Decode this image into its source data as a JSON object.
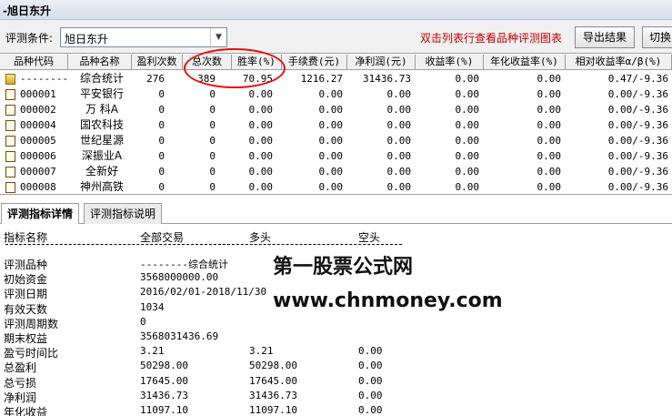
{
  "title": "-旭日东升",
  "toolbar": {
    "condition_label": "评测条件:",
    "condition_value": "旭日东升",
    "hint": "双击列表行查看品种评测图表",
    "export_label": "导出结果",
    "switch_label": "切换"
  },
  "table": {
    "headers": [
      "品种代码",
      "品种名称",
      "盈利次数",
      "总次数",
      "胜率(%)",
      "手续费(元)",
      "净利润(元)",
      "收益率(%)",
      "年化收益率(%)",
      "相对收益率α/β(%)"
    ],
    "rows": [
      {
        "code": "--------",
        "name": "综合统计",
        "win": "276",
        "total": "389",
        "rate": "70.95",
        "fee": "1216.27",
        "profit": "31436.73",
        "ret": "0.00",
        "annual": "0.00",
        "rel": "0.47/-9.36"
      },
      {
        "code": "000001",
        "name": "平安银行",
        "win": "0",
        "total": "0",
        "rate": "0.00",
        "fee": "0.00",
        "profit": "0.00",
        "ret": "0.00",
        "annual": "0.00",
        "rel": "0.00/-9.36"
      },
      {
        "code": "000002",
        "name": "万 科A",
        "win": "0",
        "total": "0",
        "rate": "0.00",
        "fee": "0.00",
        "profit": "0.00",
        "ret": "0.00",
        "annual": "0.00",
        "rel": "0.00/-9.36"
      },
      {
        "code": "000004",
        "name": "国农科技",
        "win": "0",
        "total": "0",
        "rate": "0.00",
        "fee": "0.00",
        "profit": "0.00",
        "ret": "0.00",
        "annual": "0.00",
        "rel": "0.00/-9.36"
      },
      {
        "code": "000005",
        "name": "世纪星源",
        "win": "0",
        "total": "0",
        "rate": "0.00",
        "fee": "0.00",
        "profit": "0.00",
        "ret": "0.00",
        "annual": "0.00",
        "rel": "0.00/-9.36"
      },
      {
        "code": "000006",
        "name": "深振业A",
        "win": "0",
        "total": "0",
        "rate": "0.00",
        "fee": "0.00",
        "profit": "0.00",
        "ret": "0.00",
        "annual": "0.00",
        "rel": "0.00/-9.36"
      },
      {
        "code": "000007",
        "name": "全新好",
        "win": "0",
        "total": "0",
        "rate": "0.00",
        "fee": "0.00",
        "profit": "0.00",
        "ret": "0.00",
        "annual": "0.00",
        "rel": "0.00/-9.36"
      },
      {
        "code": "000008",
        "name": "神州高铁",
        "win": "0",
        "total": "0",
        "rate": "0.00",
        "fee": "0.00",
        "profit": "0.00",
        "ret": "0.00",
        "annual": "0.00",
        "rel": "0.00/-9.36"
      }
    ]
  },
  "tabs": [
    "评测指标详情",
    "评测指标说明"
  ],
  "detail": {
    "headers": [
      "指标名称",
      "全部交易",
      "多头",
      "空头"
    ],
    "rows": [
      {
        "name": "评测品种",
        "all": "--------综合统计",
        "long": "",
        "short": ""
      },
      {
        "name": "初始资金",
        "all": "3568000000.00",
        "long": "",
        "short": ""
      },
      {
        "name": "评测日期",
        "all": "2016/02/01-2018/11/30",
        "long": "",
        "short": ""
      },
      {
        "name": "有效天数",
        "all": "1034",
        "long": "",
        "short": ""
      },
      {
        "name": "评测周期数",
        "all": "0",
        "long": "",
        "short": ""
      },
      {
        "name": "期末权益",
        "all": "3568031436.69",
        "long": "",
        "short": ""
      },
      {
        "name": "盈亏时间比",
        "all": "3.21",
        "long": "3.21",
        "short": "0.00"
      },
      {
        "name": "总盈利",
        "all": "50298.00",
        "long": "50298.00",
        "short": "0.00"
      },
      {
        "name": "总亏损",
        "all": "17645.00",
        "long": "17645.00",
        "short": "0.00"
      },
      {
        "name": "净利润",
        "all": "31436.73",
        "long": "31436.73",
        "short": "0.00"
      },
      {
        "name": "年化收益",
        "all": "11097.10",
        "long": "11097.10",
        "short": "0.00"
      }
    ]
  },
  "watermark": {
    "line1": "第一股票公式网",
    "line2": "www.chnmoney.com"
  },
  "colors": {
    "hint": "#c00000",
    "circle": "#e01010"
  },
  "icons": [
    "document-icon",
    "summary-icon",
    "chevron-down-icon"
  ]
}
